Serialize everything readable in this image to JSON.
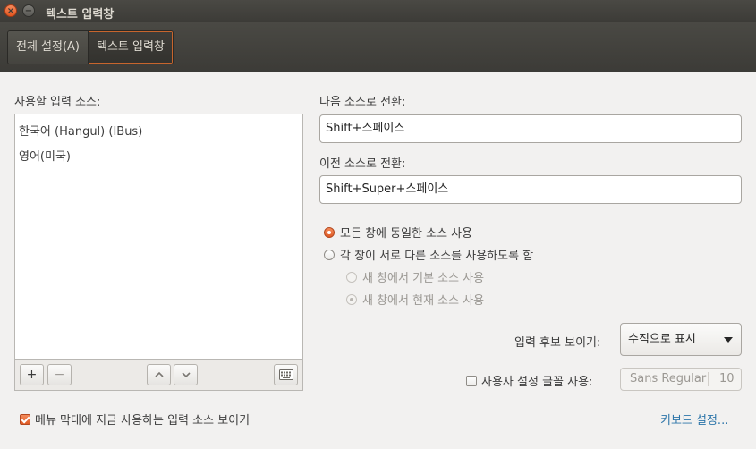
{
  "window": {
    "title": "텍스트 입력창",
    "close_glyph": "×",
    "minimize_glyph": "−"
  },
  "tabs": [
    {
      "label": "전체 설정(A)",
      "active": false
    },
    {
      "label": "텍스트 입력창",
      "active": true
    }
  ],
  "sources": {
    "label": "사용할 입력 소스:",
    "items": [
      "한국어 (Hangul) (IBus)",
      "영어(미국)"
    ],
    "toolbar": {
      "add": "+",
      "remove": "−",
      "up": "⌃",
      "down": "⌄",
      "keyboard_icon": "keyboard-icon"
    }
  },
  "switching": {
    "next_label": "다음 소스로 전환:",
    "next_value": "Shift+스페이스",
    "prev_label": "이전 소스로 전환:",
    "prev_value": "Shift+Super+스페이스"
  },
  "scope": {
    "same_source": "모든 창에 동일한 소스 사용",
    "per_window": "각 창이 서로 다른 소스를 사용하도록 함",
    "default_source": "새 창에서 기본 소스 사용",
    "current_source": "새 창에서 현재 소스 사용"
  },
  "candidates": {
    "label": "입력 후보 보이기:",
    "value": "수직으로 표시"
  },
  "custom_font": {
    "label": "사용자 설정 글꼴 사용:",
    "checked": false,
    "font_name": "Sans Regular",
    "font_size": "10"
  },
  "menubar_option": {
    "label": "메뉴 막대에 지금 사용하는 입력 소스 보이기",
    "checked": true
  },
  "keyboard_settings_link": "키보드 설정...",
  "colors": {
    "accent": "#e05b25",
    "link": "#2d75a9",
    "titlebar": "#3c3b37"
  }
}
